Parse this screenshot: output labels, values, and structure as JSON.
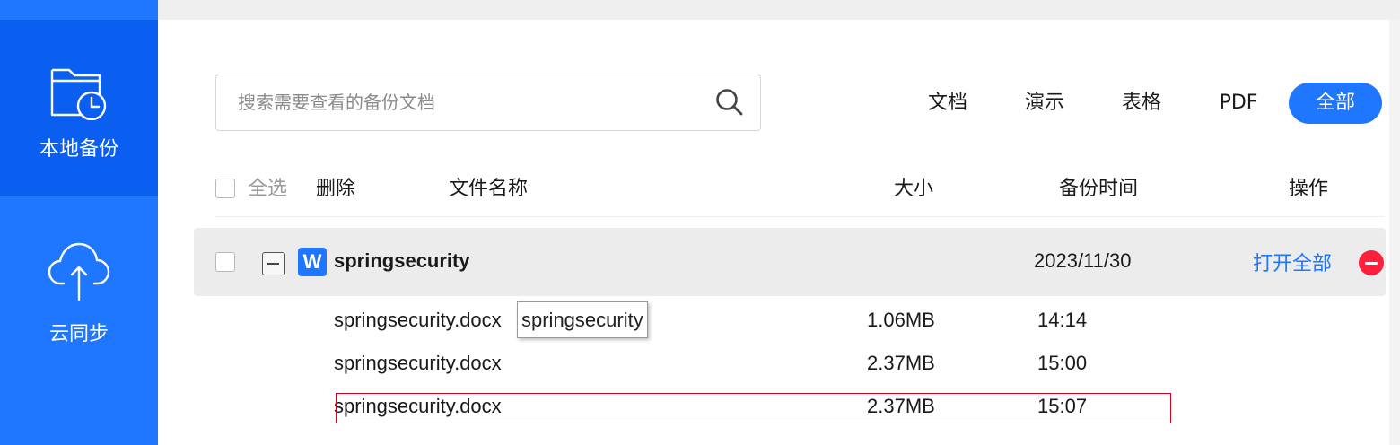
{
  "sidebar": {
    "items": [
      {
        "label": "本地备份",
        "icon": "folder-clock-icon",
        "active": true
      },
      {
        "label": "云同步",
        "icon": "cloud-upload-icon",
        "active": false
      }
    ]
  },
  "search": {
    "placeholder": "搜索需要查看的备份文档",
    "value": "",
    "icon": "search-icon"
  },
  "filters": [
    {
      "label": "文档",
      "active": false
    },
    {
      "label": "演示",
      "active": false
    },
    {
      "label": "表格",
      "active": false
    },
    {
      "label": "PDF",
      "active": false
    },
    {
      "label": "全部",
      "active": true
    }
  ],
  "table_header": {
    "select_all": "全选",
    "delete": "删除",
    "file_name": "文件名称",
    "size": "大小",
    "backup_time": "备份时间",
    "actions": "操作"
  },
  "group": {
    "icon_letter": "W",
    "name": "springsecurity",
    "date": "2023/11/30",
    "open_all": "打开全部",
    "files": [
      {
        "name": "springsecurity.docx",
        "size": "1.06MB",
        "time": "14:14"
      },
      {
        "name": "springsecurity.docx",
        "size": "2.37MB",
        "time": "15:00"
      },
      {
        "name": "springsecurity.docx",
        "size": "2.37MB",
        "time": "15:07"
      }
    ]
  },
  "tooltip": {
    "text": "springsecurity"
  },
  "colors": {
    "sidebar": "#1f76ff",
    "sidebar_active": "#0a5ef0",
    "accent": "#1f76ff",
    "remove": "#ff1f3d",
    "highlight_border": "#d0021b"
  }
}
